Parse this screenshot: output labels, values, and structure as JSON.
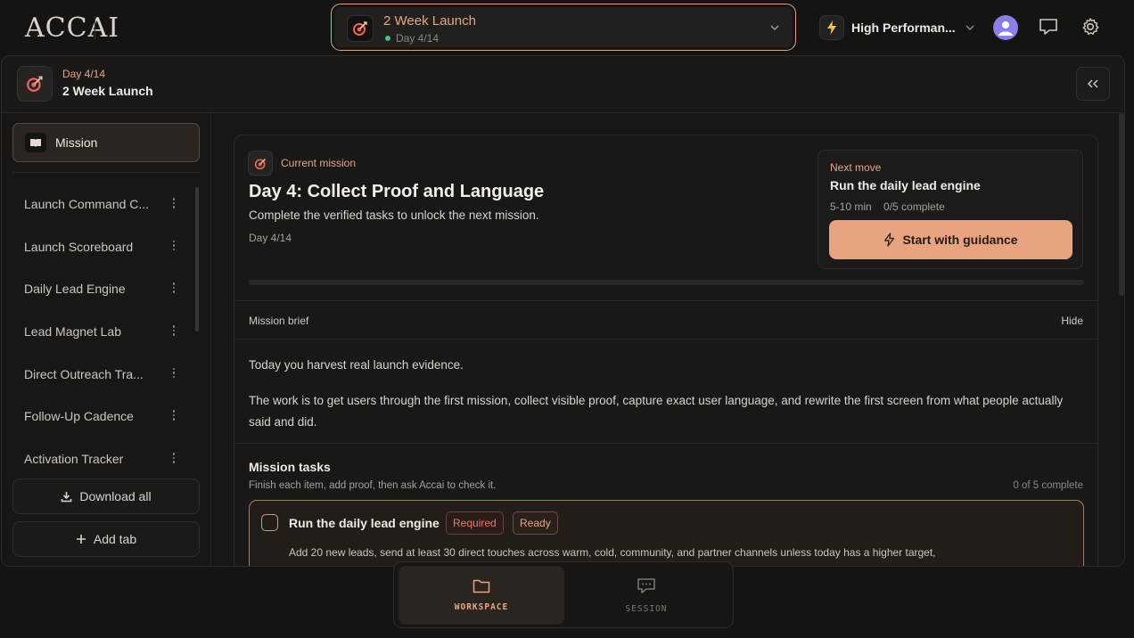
{
  "app": {
    "logo_text": "ACCAI"
  },
  "topbar": {
    "project": {
      "title": "2 Week Launch",
      "subtitle": "Day 4/14"
    },
    "mode": {
      "label": "High Performan..."
    }
  },
  "panel_header": {
    "day": "Day 4/14",
    "title": "2 Week Launch"
  },
  "sidebar": {
    "active_item": "Mission",
    "items": [
      {
        "label": "Launch Command C..."
      },
      {
        "label": "Launch Scoreboard"
      },
      {
        "label": "Daily Lead Engine"
      },
      {
        "label": "Lead Magnet Lab"
      },
      {
        "label": "Direct Outreach Tra..."
      },
      {
        "label": "Follow-Up Cadence"
      },
      {
        "label": "Activation Tracker"
      }
    ],
    "download_label": "Download all",
    "add_tab_label": "Add tab"
  },
  "mission": {
    "label": "Current mission",
    "title": "Day 4: Collect Proof and Language",
    "description": "Complete the verified tasks to unlock the next mission.",
    "day": "Day 4/14",
    "progress": 0
  },
  "next_move": {
    "label": "Next move",
    "title": "Run the daily lead engine",
    "duration": "5-10 min",
    "completion": "0/5 complete",
    "button_label": "Start with guidance"
  },
  "brief": {
    "label": "Mission brief",
    "hide_label": "Hide",
    "paragraph_1": "Today you harvest real launch evidence.",
    "paragraph_2": "The work is to get users through the first mission, collect visible proof, capture exact user language, and rewrite the first screen from what people actually said and did."
  },
  "tasks": {
    "title": "Mission tasks",
    "subtitle": "Finish each item, add proof, then ask Accai to check it.",
    "count": "0 of 5 complete",
    "items": [
      {
        "title": "Run the daily lead engine",
        "badges": [
          "Required",
          "Ready"
        ],
        "description": "Add 20 new leads, send at least 30 direct touches across warm, cold, community, and partner channels unless today has a higher target,"
      }
    ]
  },
  "dock": {
    "tabs": [
      {
        "label": "WORKSPACE",
        "active": true
      },
      {
        "label": "SESSION",
        "active": false
      }
    ]
  },
  "colors": {
    "accent": "#e8a381",
    "accent_text": "#e4a686",
    "background": "#151413",
    "success": "#4fbf83"
  }
}
